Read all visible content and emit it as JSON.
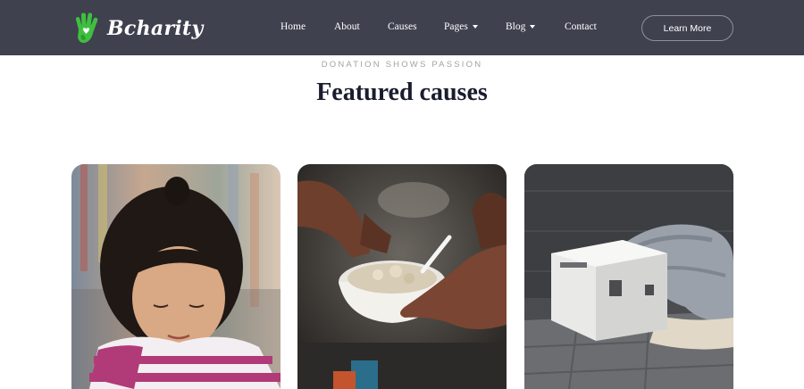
{
  "header": {
    "brand": "Bcharity",
    "logo_icon": "hand-heart-icon",
    "nav": [
      {
        "label": "Home"
      },
      {
        "label": "About"
      },
      {
        "label": "Causes"
      },
      {
        "label": "Pages",
        "dropdown": true
      },
      {
        "label": "Blog",
        "dropdown": true
      },
      {
        "label": "Contact"
      }
    ],
    "cta_label": "Learn More"
  },
  "section": {
    "eyebrow": "DONATION SHOWS PASSION",
    "title": "Featured causes"
  },
  "cards": [
    {
      "image": "girl-reading-photo"
    },
    {
      "image": "food-donation-photo"
    },
    {
      "image": "homeless-sleeping-photo"
    }
  ],
  "colors": {
    "header_bg": "#3f414f",
    "logo_green": "#3fbf3f",
    "title": "#1a1c2e",
    "eyebrow": "#a3a3a8"
  }
}
